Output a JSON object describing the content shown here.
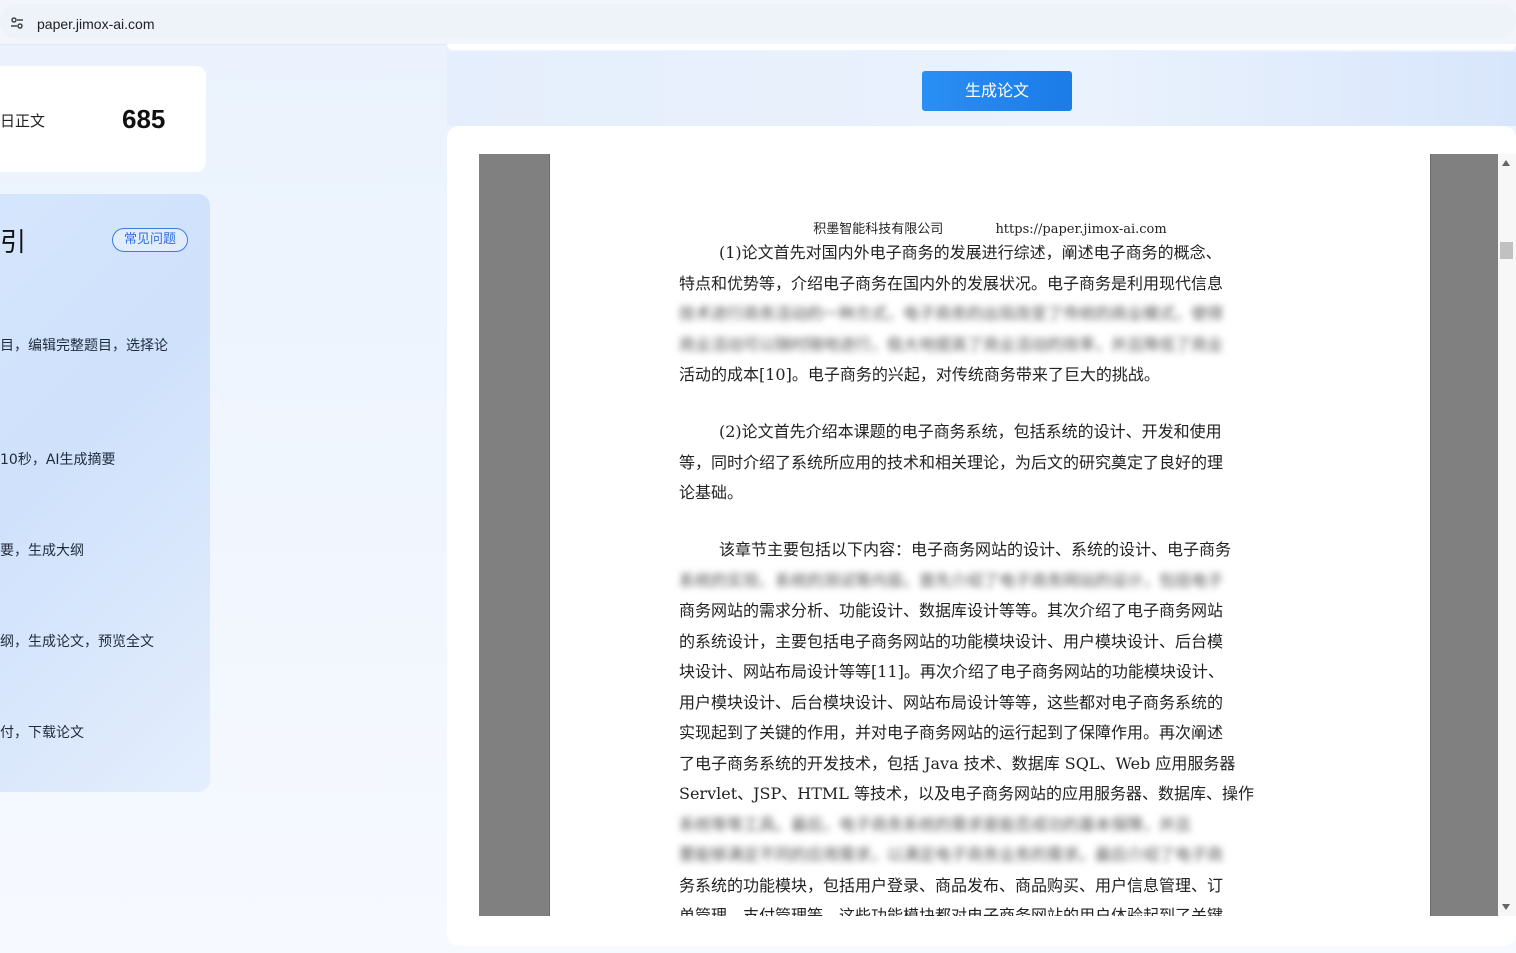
{
  "browser": {
    "url": "paper.jimox-ai.com"
  },
  "word_card": {
    "label": "日正文",
    "count": "685"
  },
  "guide": {
    "title": "引",
    "faq_label": "常见问题",
    "steps": [
      "目，编辑完整题目，选择论",
      "10秒，AI生成摘要",
      "要，生成大纲",
      "纲，生成论文，预览全文",
      "付，下载论文"
    ]
  },
  "actions": {
    "generate_label": "生成论文"
  },
  "document": {
    "header_company": "积墨智能科技有限公司",
    "header_url": "https://paper.jimox-ai.com",
    "paragraphs": [
      [
        "(1)论文首先对国内外电子商务的发展进行综述，阐述电子商务的概念、",
        "特点和优势等，介绍电子商务在国内外的发展状况。电子商务是利用现代信息",
        "技术进行商务活动的一种方式，电子商务的出现改变了传统的商业模式，使得",
        "商业活动可以随时随地进行，极大地提高了商业活动的效率，并且降低了商业",
        "活动的成本[10]。电子商务的兴起，对传统商务带来了巨大的挑战。"
      ],
      [
        "(2)论文首先介绍本课题的电子商务系统，包括系统的设计、开发和使用",
        "等，同时介绍了系统所应用的技术和相关理论，为后文的研究奠定了良好的理",
        "论基础。"
      ],
      [
        "该章节主要包括以下内容：电子商务网站的设计、系统的设计、电子商务",
        "系统的实现、系统的测试等内容。首先介绍了电子商务网站的设计，包括电子",
        "商务网站的需求分析、功能设计、数据库设计等等。其次介绍了电子商务网站",
        "的系统设计，主要包括电子商务网站的功能模块设计、用户模块设计、后台模",
        "块设计、网站布局设计等等[11]。再次介绍了电子商务网站的功能模块设计、",
        "用户模块设计、后台模块设计、网站布局设计等等，这些都对电子商务系统的",
        "实现起到了关键的作用，并对电子商务网站的运行起到了保障作用。再次阐述",
        "了电子商务系统的开发技术，包括 Java 技术、数据库 SQL、Web 应用服务器",
        "Servlet、JSP、HTML 等技术，以及电子商务网站的应用服务器、数据库、操作",
        "系统等等工具。最后，电子商务系统的需求是能否成功的基本保障，并且",
        "要能够满足不同的应用需求，以满足电子商务业务的需求。最后介绍了电子商",
        "务系统的功能模块，包括用户登录、商品发布、商品购买、用户信息管理、订",
        "单管理、支付管理等，这些功能模块都对电子商务网站的用户体验起到了关键"
      ]
    ]
  }
}
